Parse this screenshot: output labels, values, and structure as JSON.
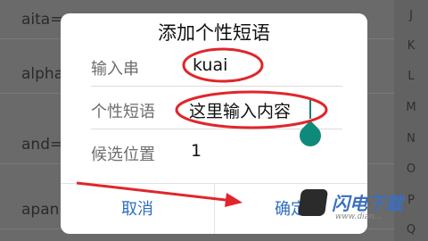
{
  "background_list": {
    "items": [
      "aita=...",
      "alpha...",
      "and=...",
      "apan..."
    ]
  },
  "alphabet_index": [
    "J",
    "K",
    "L",
    "M",
    "N",
    "O",
    "P",
    "Q"
  ],
  "dialog": {
    "title": "添加个性短语",
    "fields": [
      {
        "label": "输入串",
        "value": "kuai"
      },
      {
        "label": "个性短语",
        "value": "这里输入内容"
      },
      {
        "label": "候选位置",
        "value": "1"
      }
    ],
    "cancel_label": "取消",
    "confirm_label": "确定"
  },
  "colors": {
    "annotation_red": "#e0262b",
    "button_blue": "#2d6fc0",
    "cursor_teal": "#0f8a7a"
  },
  "watermark": {
    "brand": "闪电下载",
    "url": "www.dian..."
  }
}
